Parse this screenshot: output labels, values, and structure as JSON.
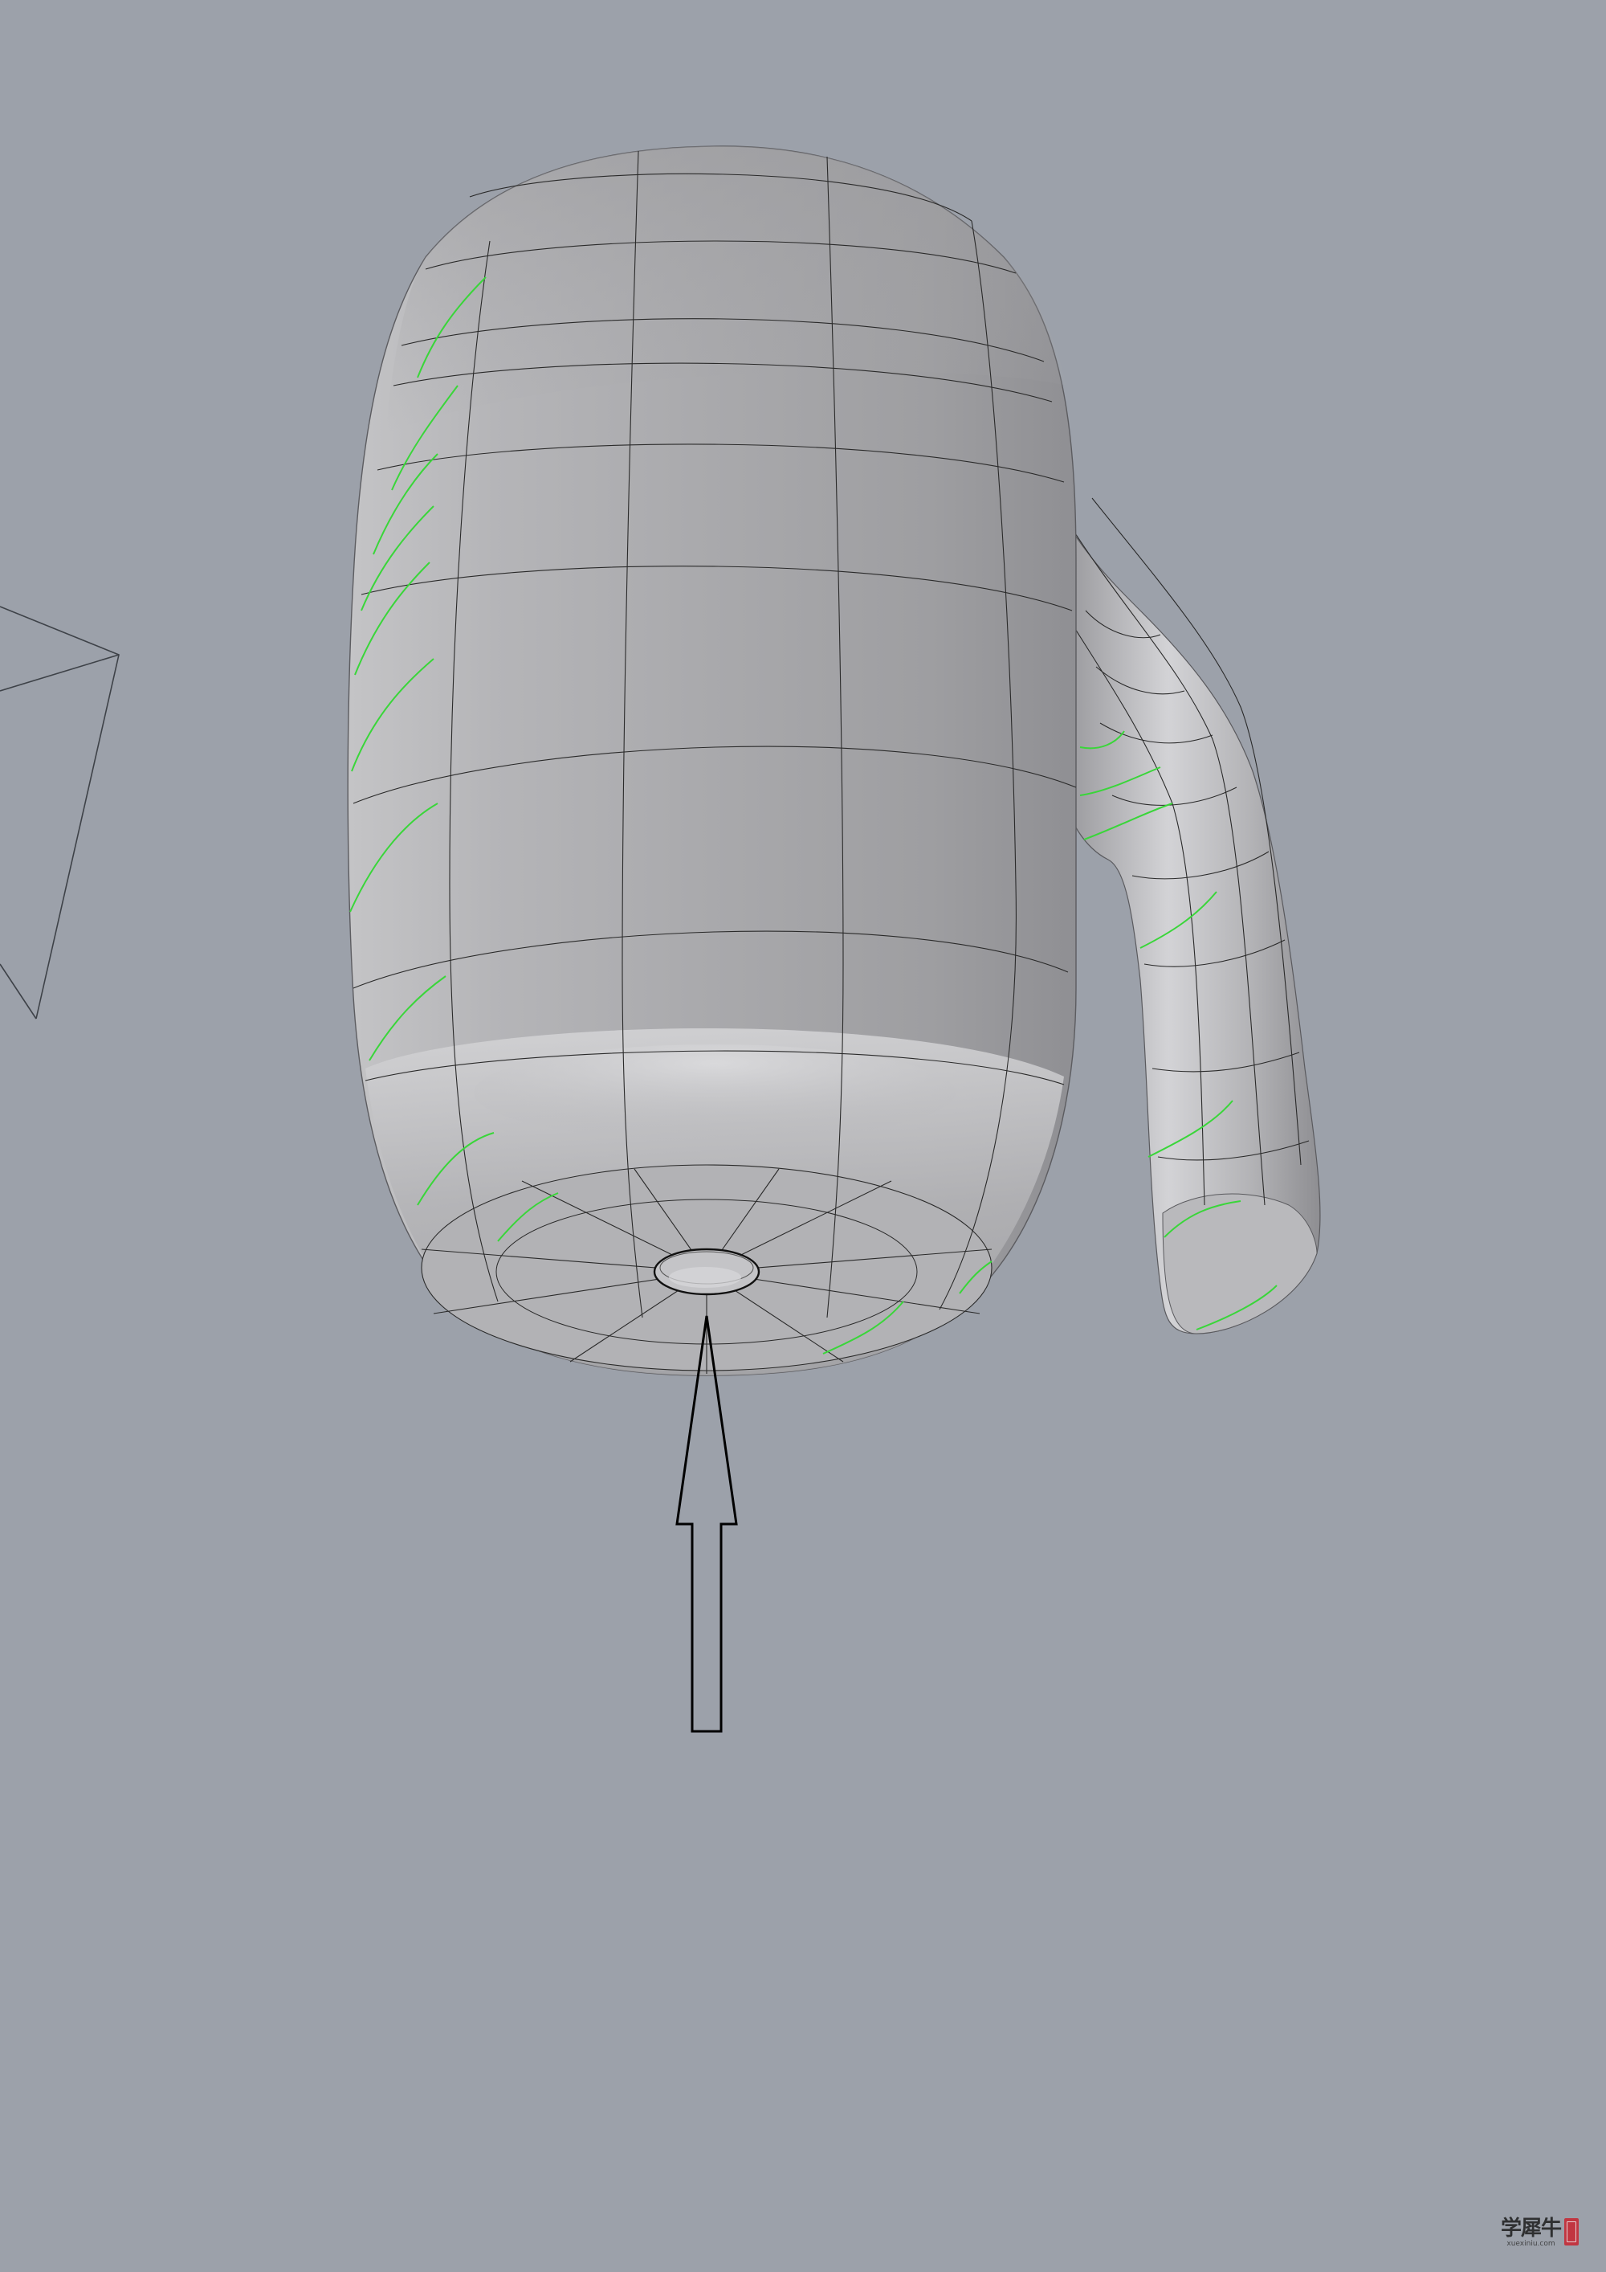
{
  "viewport": {
    "background_color": "#9ca1aa",
    "object": "mug-surface-model",
    "isocurve_color": "#2a2a2a",
    "seam_color": "#39d639",
    "arrow_direction": "up",
    "annotation": "arrow-pointing-to-bottom-hole"
  },
  "watermark": {
    "brand": "学犀牛",
    "url": "xuexiniu.com",
    "seal_color": "#c8242f"
  }
}
